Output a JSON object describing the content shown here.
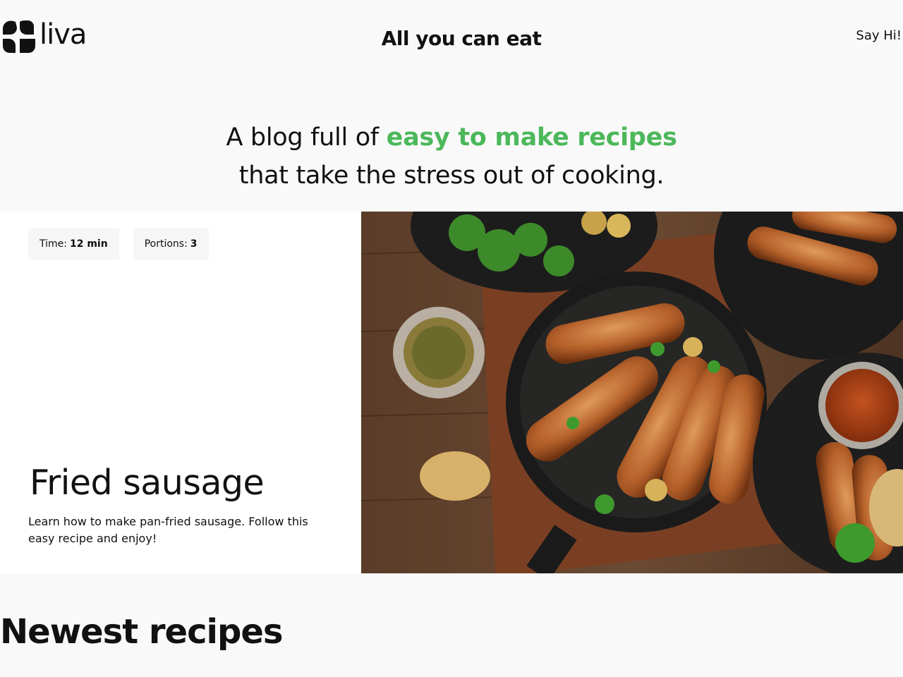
{
  "header": {
    "logo_text": "liva",
    "site_title": "All you can eat",
    "contact_link": "Say Hi!"
  },
  "hero": {
    "tagline_prefix": "A blog full of ",
    "tagline_accent": "easy to make recipes",
    "tagline_line2": "that take the stress out of cooking."
  },
  "featured": {
    "time_label": "Time:",
    "time_value": "12 min",
    "portions_label": "Portions:",
    "portions_value": "3",
    "title": "Fried sausage",
    "description": "Learn how to make pan-fried sausage. Follow this easy recipe and enjoy!"
  },
  "sections": {
    "newest_title": "Newest recipes"
  },
  "colors": {
    "accent": "#4cb85a",
    "background": "#f9f9f9",
    "card": "#ffffff",
    "chip": "#f6f6f6"
  }
}
